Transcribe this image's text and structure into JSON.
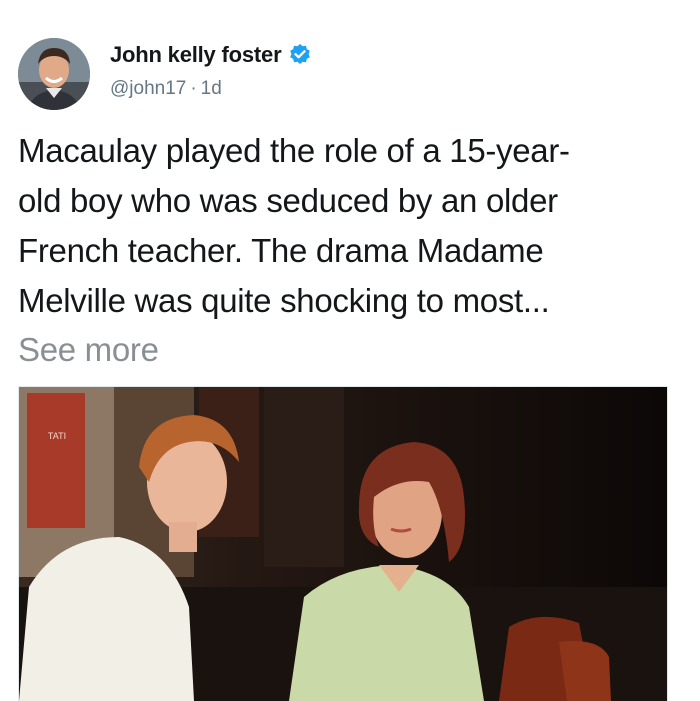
{
  "tweet": {
    "author_name": "John kelly foster",
    "handle": "@john17",
    "separator": "·",
    "age": "1d",
    "text": "Macaulay played the role of a 15-year-\nold boy who was seduced by an older\nFrench teacher. The drama Madame\nMelville was quite shocking to most...",
    "see_more_label": "See more",
    "verified_color": "#1da1f2",
    "avatar_icon": "profile-photo",
    "verified_icon": "verified-badge-icon"
  },
  "photo": {
    "poster_text": "TATI"
  }
}
